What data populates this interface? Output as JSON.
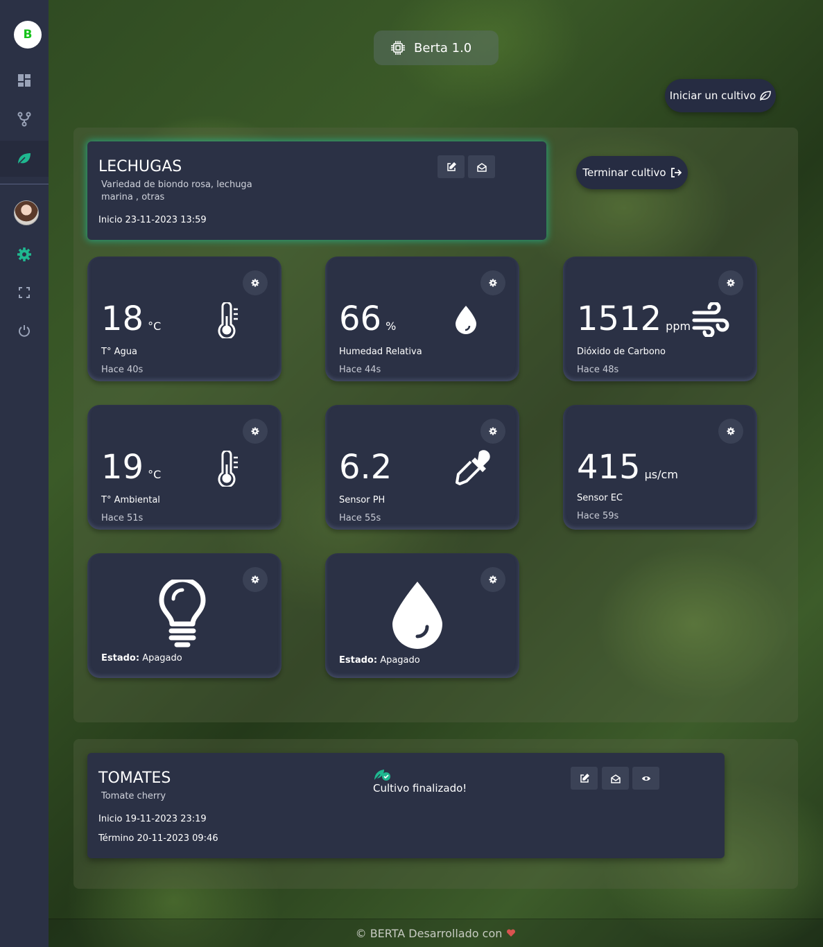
{
  "sidebar": {
    "logo_letter": "B",
    "items": [
      "dashboard",
      "fork",
      "leaf",
      "avatar",
      "settings",
      "fullscreen",
      "power"
    ]
  },
  "header": {
    "title": "Berta 1.0"
  },
  "actions": {
    "start_label": "Iniciar un cultivo",
    "end_label": "Terminar cultivo"
  },
  "active_crop": {
    "name": "LECHUGAS",
    "desc_line1": "Variedad de biondo rosa, lechuga",
    "desc_line2": "marina , otras",
    "start": "Inicio 23-11-2023 13:59"
  },
  "sensors": [
    {
      "value": "18",
      "unit": "°C",
      "label": "T° Agua",
      "ago": "Hace 40s"
    },
    {
      "value": "66",
      "unit": "%",
      "label": "Humedad Relativa",
      "ago": "Hace 44s"
    },
    {
      "value": "1512",
      "unit": "ppm",
      "label": "Dióxido de Carbono",
      "ago": "Hace 48s"
    },
    {
      "value": "19",
      "unit": "°C",
      "label": "T° Ambiental",
      "ago": "Hace 51s"
    },
    {
      "value": "6.2",
      "unit": "",
      "label": "Sensor PH",
      "ago": "Hace 55s"
    },
    {
      "value": "415",
      "unit": "µs/cm",
      "label": "Sensor EC",
      "ago": "Hace 59s"
    }
  ],
  "actuators": [
    {
      "status_label": "Estado:",
      "status_value": "Apagado"
    },
    {
      "status_label": "Estado:",
      "status_value": "Apagado"
    }
  ],
  "finished_crop": {
    "name": "TOMATES",
    "desc": "Tomate cherry",
    "start": "Inicio 19-11-2023 23:19",
    "end": "Término 20-11-2023 09:46",
    "status": "Cultivo finalizado!"
  },
  "footer": {
    "text": "© BERTA Desarrollado con"
  },
  "colors": {
    "accent": "#1fb890",
    "card_bg": "#2b3145",
    "heart": "#d9534f"
  }
}
